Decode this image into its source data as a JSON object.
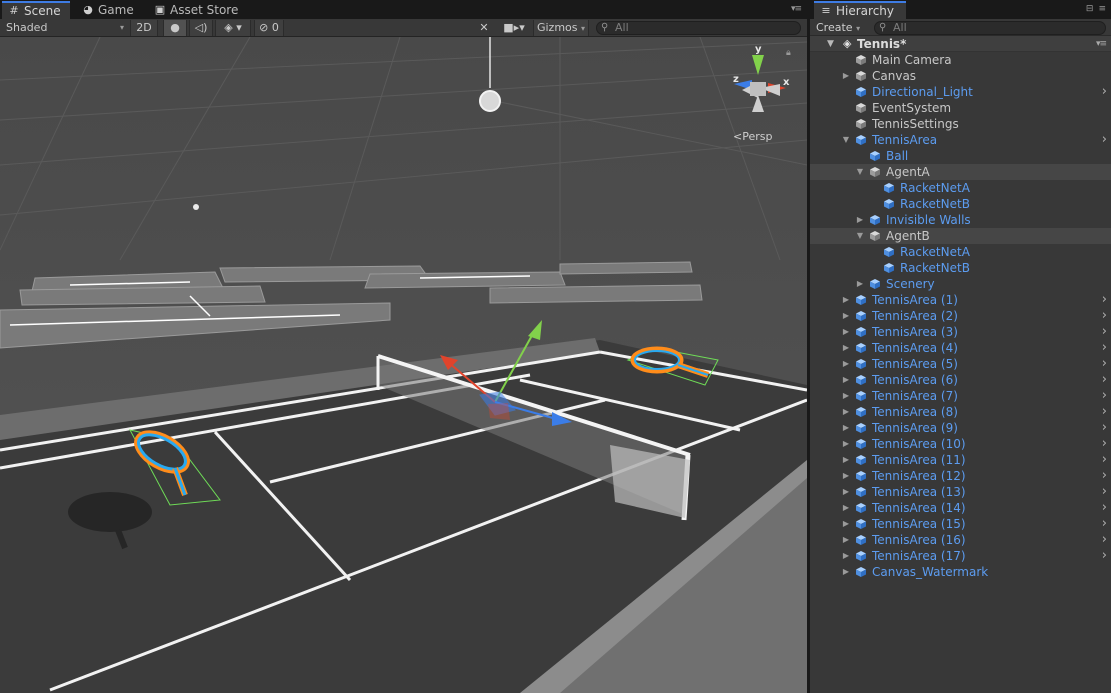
{
  "scene_tabs": [
    {
      "label": "Scene",
      "icon": "grid-icon",
      "active": true
    },
    {
      "label": "Game",
      "icon": "pacman-icon",
      "active": false
    },
    {
      "label": "Asset Store",
      "icon": "bag-icon",
      "active": false
    }
  ],
  "scene_toolbar": {
    "draw_mode": "Shaded",
    "mode_2d": "2D",
    "hidden_count": "0",
    "gizmos": "Gizmos",
    "search_placeholder": "All"
  },
  "viewport": {
    "persp_label": "Persp",
    "gizmo_axes": {
      "y": "y",
      "x": "x",
      "z": "z"
    }
  },
  "hierarchy": {
    "tab_label": "Hierarchy",
    "create_label": "Create",
    "search_placeholder": "All",
    "scene_name": "Tennis*",
    "rows": [
      {
        "label": "Main Camera",
        "indent": 0,
        "fold": "",
        "color": "gray",
        "chevron": false,
        "highlight": false
      },
      {
        "label": "Canvas",
        "indent": 0,
        "fold": "right",
        "color": "gray",
        "chevron": false,
        "highlight": false
      },
      {
        "label": "Directional_Light",
        "indent": 0,
        "fold": "",
        "color": "blue",
        "chevron": true,
        "highlight": false
      },
      {
        "label": "EventSystem",
        "indent": 0,
        "fold": "",
        "color": "gray",
        "chevron": false,
        "highlight": false
      },
      {
        "label": "TennisSettings",
        "indent": 0,
        "fold": "",
        "color": "gray",
        "chevron": false,
        "highlight": false
      },
      {
        "label": "TennisArea",
        "indent": 0,
        "fold": "down",
        "color": "blue",
        "chevron": true,
        "highlight": false
      },
      {
        "label": "Ball",
        "indent": 1,
        "fold": "",
        "color": "blue",
        "chevron": false,
        "highlight": false
      },
      {
        "label": "AgentA",
        "indent": 1,
        "fold": "down",
        "color": "gray",
        "chevron": false,
        "highlight": true
      },
      {
        "label": "RacketNetA",
        "indent": 2,
        "fold": "",
        "color": "blue",
        "chevron": false,
        "highlight": false
      },
      {
        "label": "RacketNetB",
        "indent": 2,
        "fold": "",
        "color": "blue",
        "chevron": false,
        "highlight": false
      },
      {
        "label": "Invisible Walls",
        "indent": 1,
        "fold": "right",
        "color": "blue",
        "chevron": false,
        "highlight": false
      },
      {
        "label": "AgentB",
        "indent": 1,
        "fold": "down",
        "color": "gray",
        "chevron": false,
        "highlight": true
      },
      {
        "label": "RacketNetA",
        "indent": 2,
        "fold": "",
        "color": "blue",
        "chevron": false,
        "highlight": false
      },
      {
        "label": "RacketNetB",
        "indent": 2,
        "fold": "",
        "color": "blue",
        "chevron": false,
        "highlight": false
      },
      {
        "label": "Scenery",
        "indent": 1,
        "fold": "right",
        "color": "blue",
        "chevron": false,
        "highlight": false
      },
      {
        "label": "TennisArea (1)",
        "indent": 0,
        "fold": "right",
        "color": "blue",
        "chevron": true,
        "highlight": false
      },
      {
        "label": "TennisArea (2)",
        "indent": 0,
        "fold": "right",
        "color": "blue",
        "chevron": true,
        "highlight": false
      },
      {
        "label": "TennisArea (3)",
        "indent": 0,
        "fold": "right",
        "color": "blue",
        "chevron": true,
        "highlight": false
      },
      {
        "label": "TennisArea (4)",
        "indent": 0,
        "fold": "right",
        "color": "blue",
        "chevron": true,
        "highlight": false
      },
      {
        "label": "TennisArea (5)",
        "indent": 0,
        "fold": "right",
        "color": "blue",
        "chevron": true,
        "highlight": false
      },
      {
        "label": "TennisArea (6)",
        "indent": 0,
        "fold": "right",
        "color": "blue",
        "chevron": true,
        "highlight": false
      },
      {
        "label": "TennisArea (7)",
        "indent": 0,
        "fold": "right",
        "color": "blue",
        "chevron": true,
        "highlight": false
      },
      {
        "label": "TennisArea (8)",
        "indent": 0,
        "fold": "right",
        "color": "blue",
        "chevron": true,
        "highlight": false
      },
      {
        "label": "TennisArea (9)",
        "indent": 0,
        "fold": "right",
        "color": "blue",
        "chevron": true,
        "highlight": false
      },
      {
        "label": "TennisArea (10)",
        "indent": 0,
        "fold": "right",
        "color": "blue",
        "chevron": true,
        "highlight": false
      },
      {
        "label": "TennisArea (11)",
        "indent": 0,
        "fold": "right",
        "color": "blue",
        "chevron": true,
        "highlight": false
      },
      {
        "label": "TennisArea (12)",
        "indent": 0,
        "fold": "right",
        "color": "blue",
        "chevron": true,
        "highlight": false
      },
      {
        "label": "TennisArea (13)",
        "indent": 0,
        "fold": "right",
        "color": "blue",
        "chevron": true,
        "highlight": false
      },
      {
        "label": "TennisArea (14)",
        "indent": 0,
        "fold": "right",
        "color": "blue",
        "chevron": true,
        "highlight": false
      },
      {
        "label": "TennisArea (15)",
        "indent": 0,
        "fold": "right",
        "color": "blue",
        "chevron": true,
        "highlight": false
      },
      {
        "label": "TennisArea (16)",
        "indent": 0,
        "fold": "right",
        "color": "blue",
        "chevron": true,
        "highlight": false
      },
      {
        "label": "TennisArea (17)",
        "indent": 0,
        "fold": "right",
        "color": "blue",
        "chevron": true,
        "highlight": false
      },
      {
        "label": "Canvas_Watermark",
        "indent": 0,
        "fold": "right",
        "color": "blue",
        "chevron": false,
        "highlight": false
      }
    ]
  },
  "colors": {
    "accent": "#3e7ce4",
    "prefab_blue": "#5c9cf0",
    "axis_x": "#e0442c",
    "axis_y": "#82d14b",
    "axis_z": "#3b7de8",
    "racket_orange": "#ff8c1a"
  }
}
